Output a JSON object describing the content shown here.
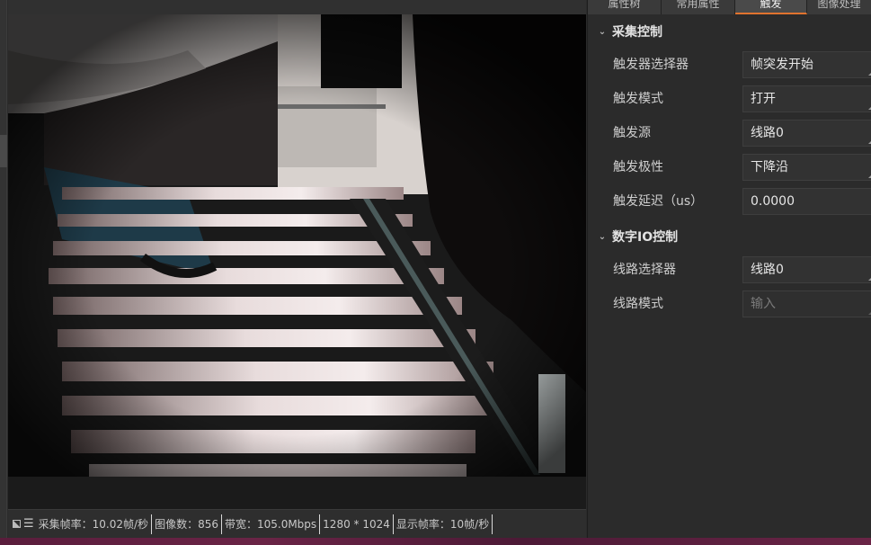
{
  "tabs": [
    {
      "label": "属性树"
    },
    {
      "label": "常用属性"
    },
    {
      "label": "触发"
    },
    {
      "label": "图像处理"
    }
  ],
  "sections": {
    "acquisition": {
      "title": "采集控制",
      "rows": [
        {
          "label": "触发器选择器",
          "value": "帧突发开始"
        },
        {
          "label": "触发模式",
          "value": "打开"
        },
        {
          "label": "触发源",
          "value": "线路0"
        },
        {
          "label": "触发极性",
          "value": "下降沿"
        },
        {
          "label": "触发延迟（us）",
          "value": "0.0000"
        }
      ]
    },
    "digital_io": {
      "title": "数字IO控制",
      "rows": [
        {
          "label": "线路选择器",
          "value": "线路0"
        },
        {
          "label": "线路模式",
          "value": "输入"
        }
      ]
    }
  },
  "status": {
    "frame_rate": "采集帧率：10.02帧/秒",
    "image_count": "图像数：856",
    "bandwidth": "带宽：105.0Mbps",
    "resolution": "1280 * 1024",
    "display_rate": "显示帧率：10帧/秒"
  },
  "colors": {
    "accent": "#e0732f",
    "panel_bg": "#2b2b2b",
    "bottom_strip": "#5a1d3c"
  }
}
